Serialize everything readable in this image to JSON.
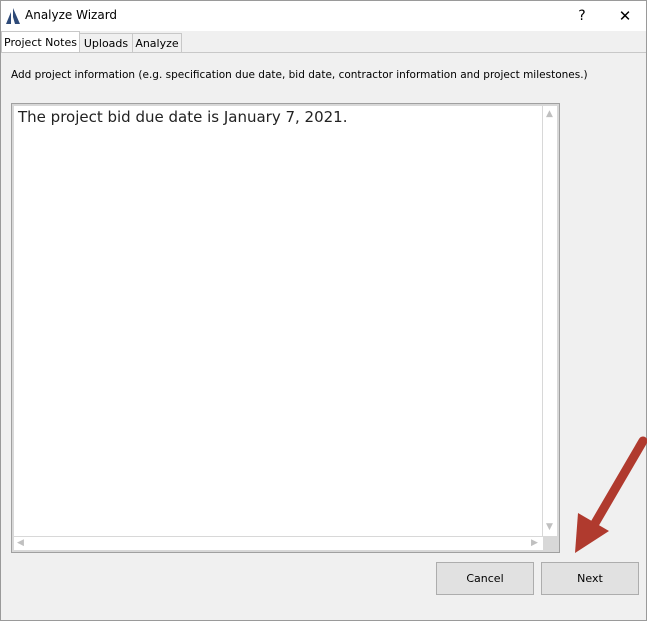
{
  "window": {
    "title": "Analyze Wizard",
    "help_label": "?",
    "close_label": "✕"
  },
  "tabs": [
    {
      "label": "Project Notes",
      "active": true
    },
    {
      "label": "Uploads",
      "active": false
    },
    {
      "label": "Analyze",
      "active": false
    }
  ],
  "project_notes": {
    "instruction": "Add project information (e.g. specification due date, bid date, contractor information and project milestones.)",
    "notes_text": "The project bid due date is January 7, 2021."
  },
  "buttons": {
    "cancel_label": "Cancel",
    "next_label": "Next"
  },
  "annotation": {
    "color": "#b03a2e"
  },
  "colors": {
    "app_icon": "#2e4a78"
  }
}
